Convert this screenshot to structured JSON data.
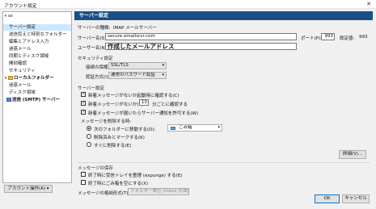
{
  "window": {
    "title": "アカウント設定",
    "close_glyph": "✕"
  },
  "tree": {
    "search_value": "ss",
    "items": [
      {
        "label": "",
        "kind": "account"
      },
      {
        "label": "サーバー設定",
        "kind": "child",
        "selected": true
      },
      {
        "label": "送信控えと特別なフォルダー",
        "kind": "child"
      },
      {
        "label": "編集とアドレス入力",
        "kind": "child"
      },
      {
        "label": "迷惑メール",
        "kind": "child"
      },
      {
        "label": "同期とディスク領域",
        "kind": "child"
      },
      {
        "label": "開封確認",
        "kind": "child"
      },
      {
        "label": "セキュリティ",
        "kind": "child"
      },
      {
        "label": "ローカルフォルダー",
        "kind": "group"
      },
      {
        "label": "迷惑メール",
        "kind": "child"
      },
      {
        "label": "ディスク領域",
        "kind": "child"
      },
      {
        "label": "送信 (SMTP) サーバー",
        "kind": "group"
      }
    ],
    "account_actions_label": "アカウント操作(A)",
    "account_actions_arrow": "▾"
  },
  "server": {
    "header": "サーバー設定",
    "type_label": "サーバーの種類:",
    "type_value": "IMAP メールサーバー",
    "server_label": "サーバー名(S):",
    "server_value": "secure.emailsrvr.com",
    "port_label": "ポート(P):",
    "port_value": "993",
    "default_label": "既定値:",
    "default_value": "993",
    "user_label": "ユーザー名(N):",
    "user_value": "作成したメールアドレス"
  },
  "security": {
    "title": "セキュリティ設定",
    "conn_label": "接続の保護(U):",
    "conn_value": "SSL/TLS",
    "auth_label": "認証方式(I):",
    "auth_value": "通常のパスワード認証"
  },
  "server_settings": {
    "title": "サーバー設定",
    "check_startup": "新着メッセージがないか起動時に確認する(C)",
    "check_every_pre": "新着メッセージがないか(Y)",
    "check_every_value": "10",
    "check_every_post": "分ごとに確認する",
    "allow_notify": "新着メッセージが届いたらサーバー通知を許可する(W)",
    "delete_title": "メッセージを削除する時:",
    "move_to": "次のフォルダーに移動する(D):",
    "trash_folder": "ごみ箱",
    "mark_deleted": "削除済みとマークする(K)",
    "delete_now": "すぐに削除する(E)",
    "advanced_btn": "詳細(V)..."
  },
  "storage": {
    "title": "メッセージの保存",
    "clean_exit": "終了時に受信トレイを整理 (expunge) する(E)",
    "empty_trash": "終了時にごみ箱を空にする(X)",
    "store_label": "メッセージの格納形式(T):",
    "store_value": "フォルダー単位 (mbox 形式)"
  },
  "buttons": {
    "ok": "OK",
    "cancel": "キャンセル"
  },
  "colors": {
    "header_bg": "#1a4f88",
    "selection": "#cce8ff",
    "accent": "#0078d7"
  }
}
